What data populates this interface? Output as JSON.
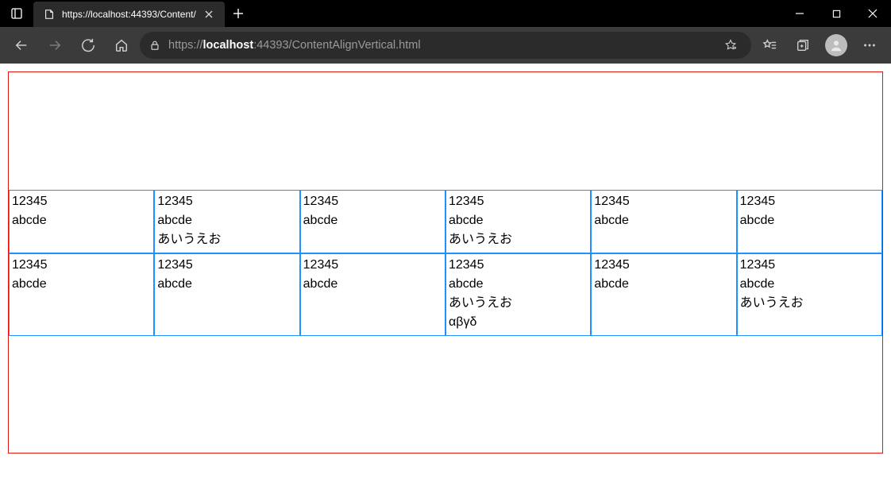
{
  "browser": {
    "tab_title": "https://localhost:44393/Content/",
    "url_parts": {
      "scheme": "https://",
      "host_strong": "localhost",
      "host_rest": ":44393",
      "path": "/ContentAlignVertical.html"
    }
  },
  "grid": {
    "row1": [
      [
        "12345",
        "abcde"
      ],
      [
        "12345",
        "abcde",
        "あいうえお"
      ],
      [
        "12345",
        "abcde"
      ],
      [
        "12345",
        "abcde",
        "あいうえお"
      ],
      [
        "12345",
        "abcde"
      ],
      [
        "12345",
        "abcde"
      ]
    ],
    "row2": [
      [
        "12345",
        "abcde"
      ],
      [
        "12345",
        "abcde"
      ],
      [
        "12345",
        "abcde"
      ],
      [
        "12345",
        "abcde",
        "あいうえお",
        "αβγδ"
      ],
      [
        "12345",
        "abcde"
      ],
      [
        "12345",
        "abcde",
        "あいうえお"
      ]
    ]
  }
}
